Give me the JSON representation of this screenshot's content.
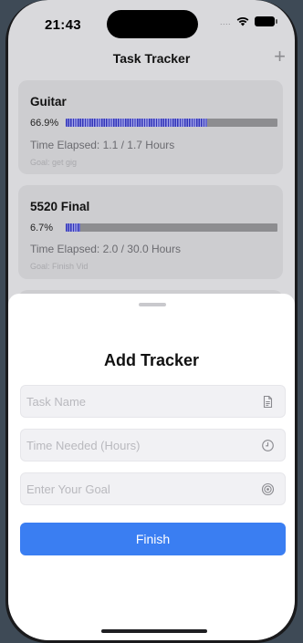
{
  "status_bar": {
    "time": "21:43",
    "signal_dots": "....",
    "icons": [
      "wifi-icon",
      "battery-icon"
    ]
  },
  "nav": {
    "title": "Task Tracker",
    "add_icon": "plus-icon"
  },
  "trackers": [
    {
      "title": "Guitar",
      "percent_label": "66.9%",
      "progress": 0.669,
      "elapsed": "Time Elapsed: 1.1 / 1.7 Hours",
      "goal": "Goal: get gig"
    },
    {
      "title": "5520 Final",
      "percent_label": "6.7%",
      "progress": 0.067,
      "elapsed": "Time Elapsed: 2.0 / 30.0 Hours",
      "goal": "Goal: Finish Vid"
    }
  ],
  "sheet": {
    "title": "Add Tracker",
    "fields": [
      {
        "placeholder": "Task Name",
        "value": "",
        "icon": "document-icon"
      },
      {
        "placeholder": "Time Needed (Hours)",
        "value": "",
        "icon": "clock-icon"
      },
      {
        "placeholder": "Enter Your Goal",
        "value": "",
        "icon": "target-icon"
      }
    ],
    "submit_label": "Finish"
  },
  "colors": {
    "accent": "#3a7ef2",
    "progress": "#3134b8",
    "track": "#8d8d90"
  }
}
